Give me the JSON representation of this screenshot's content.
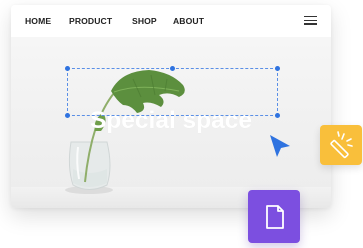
{
  "nav": {
    "items": [
      {
        "label": "HOME"
      },
      {
        "label": "PRODUCT"
      },
      {
        "label": "SHOP"
      },
      {
        "label": "ABOUT"
      }
    ],
    "menu_icon": "hamburger-menu-icon"
  },
  "hero": {
    "headline": "Special space",
    "image": "plant-in-glass-vase"
  },
  "selection": {
    "border_color": "#5a8fe6",
    "handle_color": "#2f73e0"
  },
  "tools": {
    "magic_wand": {
      "icon": "magic-wand-icon",
      "color": "#f9bf3b"
    },
    "new_page": {
      "icon": "document-icon",
      "color": "#7c4fe0"
    }
  },
  "cursor": {
    "icon": "pointer-cursor-icon",
    "color": "#2f73e0"
  }
}
